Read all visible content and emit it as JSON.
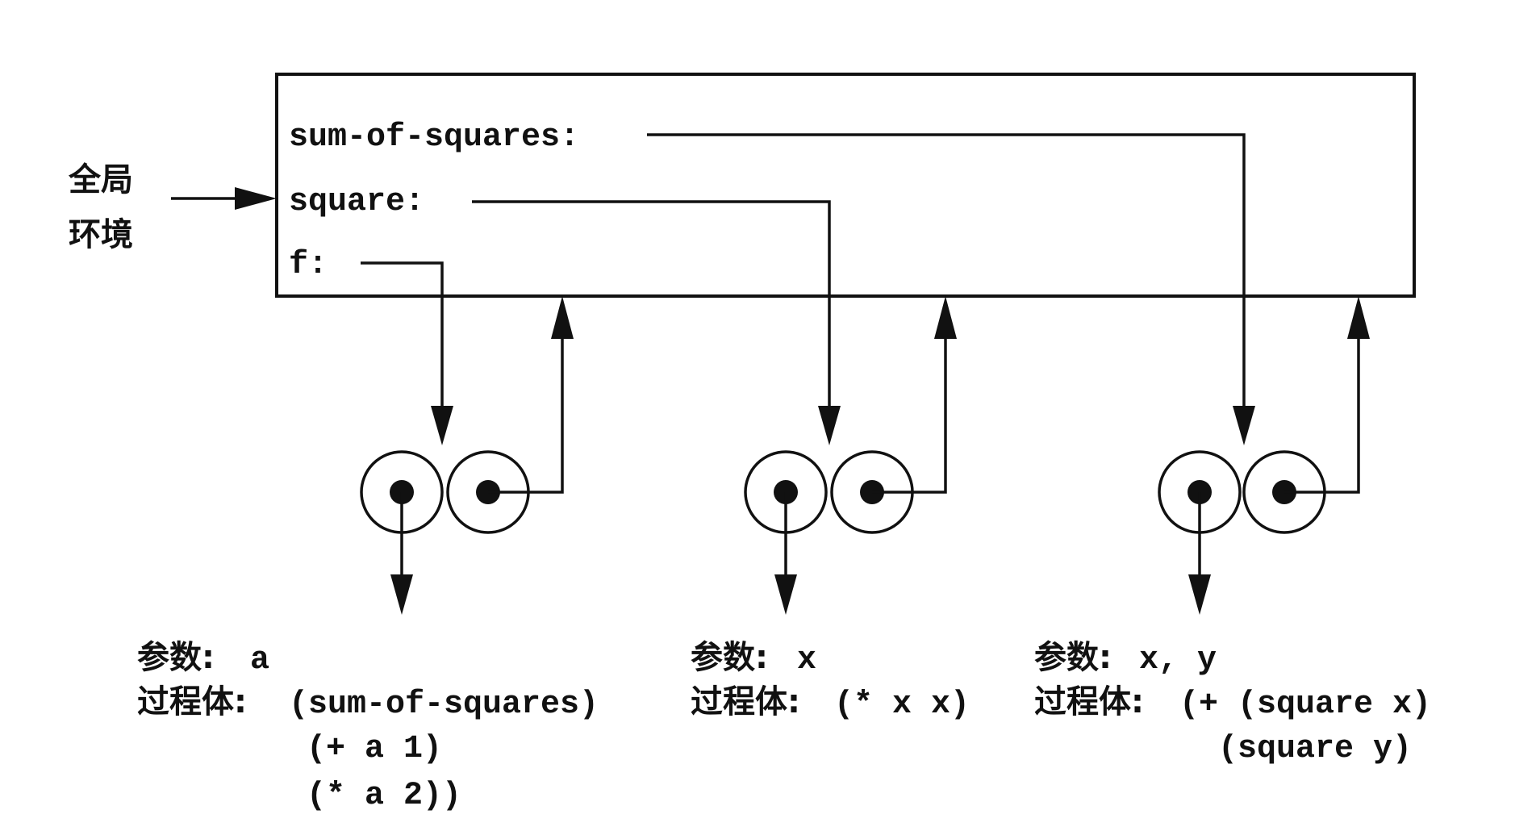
{
  "global_env_label_line1": "全局",
  "global_env_label_line2": "环境",
  "bindings": [
    {
      "name": "sum-of-squares:"
    },
    {
      "name": "square:"
    },
    {
      "name": "f:"
    }
  ],
  "procedures": [
    {
      "params_label": "参数:",
      "params_value": "a",
      "body_label": "过程体:",
      "body_lines": [
        "(sum-of-squares)",
        "(+ a 1)",
        "(* a 2))"
      ]
    },
    {
      "params_label": "参数:",
      "params_value": "x",
      "body_label": "过程体:",
      "body_lines": [
        "(* x x)"
      ]
    },
    {
      "params_label": "参数:",
      "params_value": "x, y",
      "body_label": "过程体:",
      "body_lines": [
        "(+ (square x)",
        "(square y)"
      ]
    }
  ]
}
